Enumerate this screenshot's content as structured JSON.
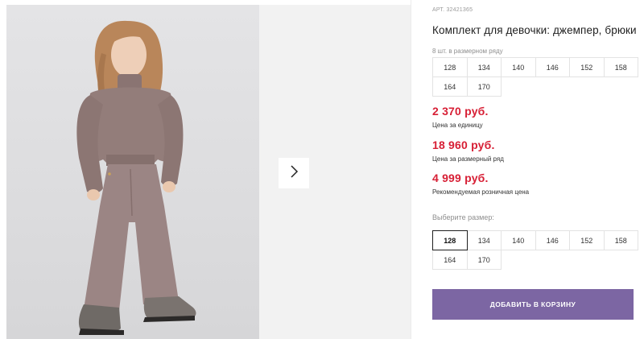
{
  "product": {
    "article_label": "АРТ.",
    "article_number": "32421365",
    "title": "Комплект для девочки: джемпер, брюки",
    "row_note": "8 шт. в размерном ряду",
    "row_sizes": [
      "128",
      "134",
      "140",
      "146",
      "152",
      "158",
      "164",
      "170"
    ]
  },
  "prices": {
    "unit_price": "2 370 руб.",
    "unit_caption": "Цена за единицу",
    "row_price": "18 960 руб.",
    "row_caption": "Цена за размерный ряд",
    "retail_price": "4 999 руб.",
    "retail_caption": "Рекомендуемая розничная цена",
    "price_color": "#d71f35"
  },
  "size_picker": {
    "label": "Выберите размер:",
    "sizes": [
      "128",
      "134",
      "140",
      "146",
      "152",
      "158",
      "164",
      "170"
    ],
    "selected": "128"
  },
  "cart": {
    "button_label": "ДОБАВИТЬ В КОРЗИНУ",
    "button_color": "#7c66a3"
  },
  "gallery": {
    "next_icon": "chevron-right-icon",
    "photo_subject": "girl-in-knit-set-photo"
  }
}
